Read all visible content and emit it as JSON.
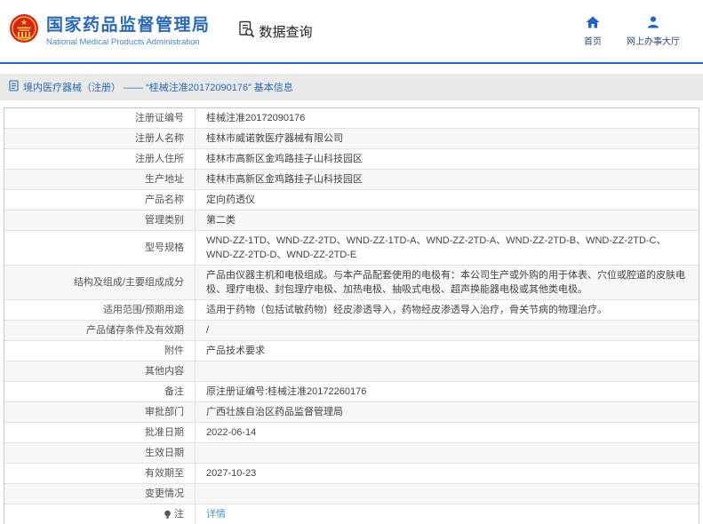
{
  "header": {
    "org_name": "国家药品监督管理局",
    "org_name_en": "National Medical Products Administration",
    "menu_data_query": "数据查询",
    "nav_home": "首页",
    "nav_service_hall": "网上办事大厅"
  },
  "breadcrumb": {
    "text": "境内医疗器械（注册） —— “桂械注准20172090176” 基本信息"
  },
  "colors": {
    "brand_blue": "#2a68b7",
    "divider_blue": "#2464b4",
    "nav_icon_blue": "#2464c4",
    "link_blue": "#4d94e0",
    "breadcrumb_bg": "#e9e9e9",
    "alt_row_bg": "#f7f7f7"
  },
  "table": {
    "rows": [
      {
        "label": "注册证编号",
        "value": "桂械注准20172090176"
      },
      {
        "label": "注册人名称",
        "value": "桂林市威诺敦医疗器械有限公司"
      },
      {
        "label": "注册人住所",
        "value": "桂林市高新区金鸡路挂子山科技园区"
      },
      {
        "label": "生产地址",
        "value": "桂林市高新区金鸡路挂子山科技园区"
      },
      {
        "label": "产品名称",
        "value": "定向药透仪"
      },
      {
        "label": "管理类别",
        "value": "第二类"
      },
      {
        "label": "型号规格",
        "value": "WND-ZZ-1TD、WND-ZZ-2TD、WND-ZZ-1TD-A、WND-ZZ-2TD-A、WND-ZZ-2TD-B、WND-ZZ-2TD-C、WND-ZZ-2TD-D、WND-ZZ-2TD-E"
      },
      {
        "label": "结构及组成/主要组成成分",
        "value": "产品由仪器主机和电极组成。与本产品配套使用的电极有：本公司生产或外购的用于体表、穴位或腔道的皮肤电极、理疗电极、封包理疗电极、加热电极、抽吸式电极、超声换能器电极或其他类电极。"
      },
      {
        "label": "适用范围/预期用途",
        "value": "适用于药物（包括试敏药物）经皮渗透导入，药物经皮渗透导入治疗，骨关节病的物理治疗。"
      },
      {
        "label": "产品储存条件及有效期",
        "value": "/"
      },
      {
        "label": "附件",
        "value": "产品技术要求"
      },
      {
        "label": "其他内容",
        "value": ""
      },
      {
        "label": "备注",
        "value": "原注册证编号:桂械注准20172260176"
      },
      {
        "label": "审批部门",
        "value": "广西壮族自治区药品监督管理局"
      },
      {
        "label": "批准日期",
        "value": "2022-06-14"
      },
      {
        "label": "生效日期",
        "value": ""
      },
      {
        "label": "有效期至",
        "value": "2027-10-23"
      },
      {
        "label": "变更情况",
        "value": ""
      },
      {
        "label": "注",
        "value": "详情",
        "link": true,
        "icon": "bulb-icon"
      }
    ]
  }
}
